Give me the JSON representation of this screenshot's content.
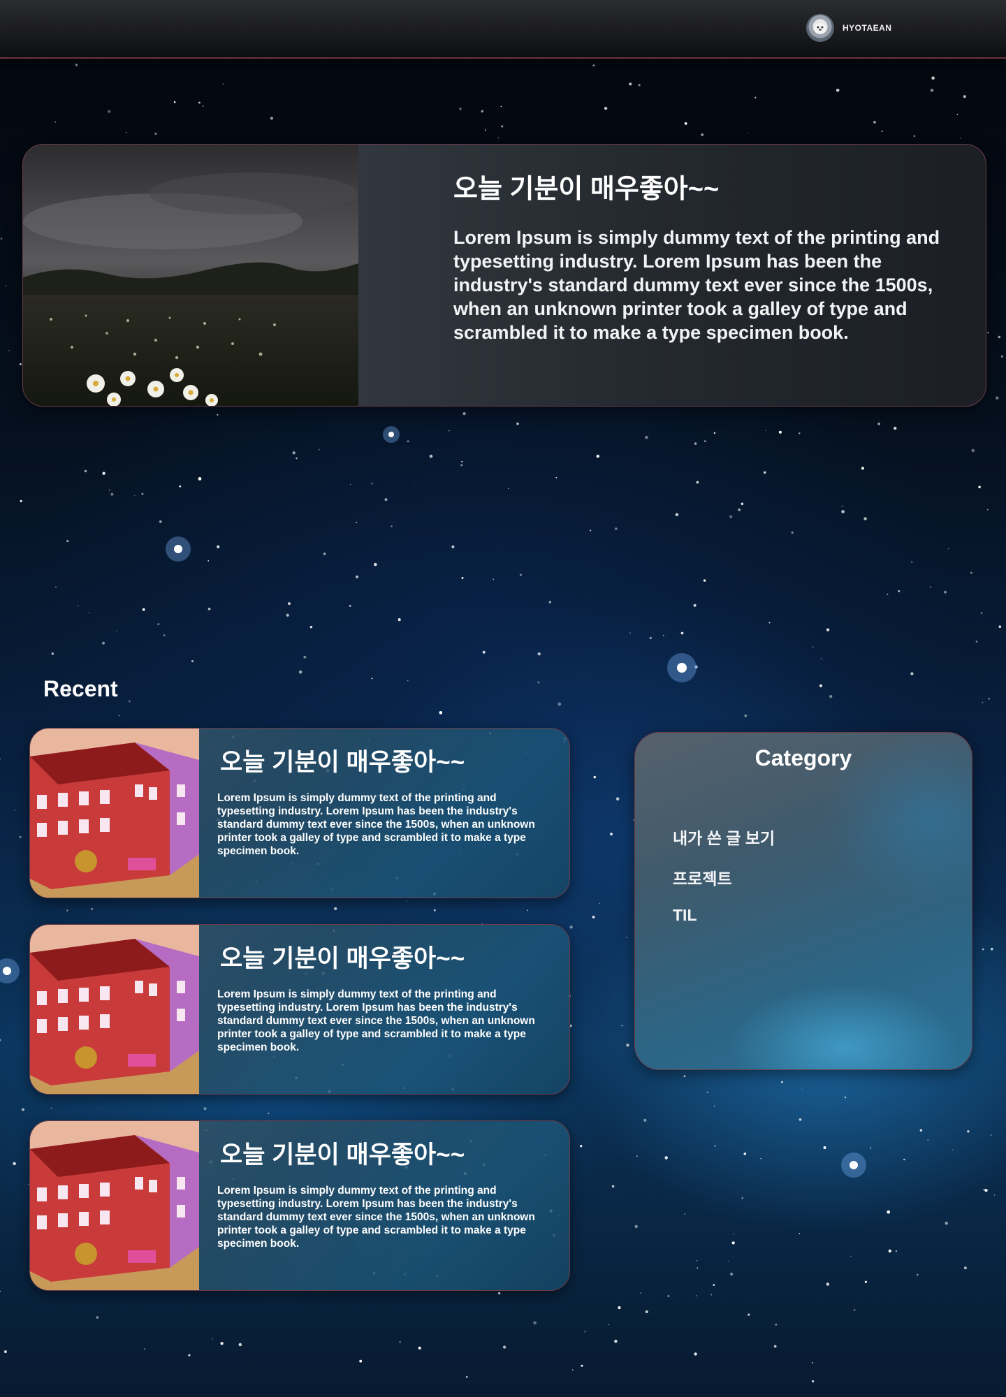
{
  "header": {
    "username": "HYOTAEAN"
  },
  "featured": {
    "title": "오늘 기분이 매우좋아~~",
    "text": "Lorem Ipsum is simply dummy text of the printing and typesetting industry. Lorem Ipsum has been the industry's standard dummy text ever since the 1500s, when an unknown printer took a galley of type and scrambled it to make a type specimen book."
  },
  "recent": {
    "heading": "Recent",
    "posts": [
      {
        "title": "오늘 기분이 매우좋아~~",
        "text": "Lorem Ipsum is simply dummy text of the printing and typesetting industry. Lorem Ipsum has been the industry's standard dummy text ever since the 1500s, when an unknown printer took a galley of type and scrambled it to make a type specimen book."
      },
      {
        "title": "오늘 기분이 매우좋아~~",
        "text": "Lorem Ipsum is simply dummy text of the printing and typesetting industry. Lorem Ipsum has been the industry's standard dummy text ever since the 1500s, when an unknown printer took a galley of type and scrambled it to make a type specimen book."
      },
      {
        "title": "오늘 기분이 매우좋아~~",
        "text": "Lorem Ipsum is simply dummy text of the printing and typesetting industry. Lorem Ipsum has been the industry's standard dummy text ever since the 1500s, when an unknown printer took a galley of type and scrambled it to make a type specimen book."
      }
    ]
  },
  "category": {
    "title": "Category",
    "items": [
      "내가 쓴 글 보기",
      "프로젝트",
      "TIL"
    ]
  },
  "colors": {
    "border_accent": "#6c3c47",
    "header_bg": "#1b1c20"
  }
}
